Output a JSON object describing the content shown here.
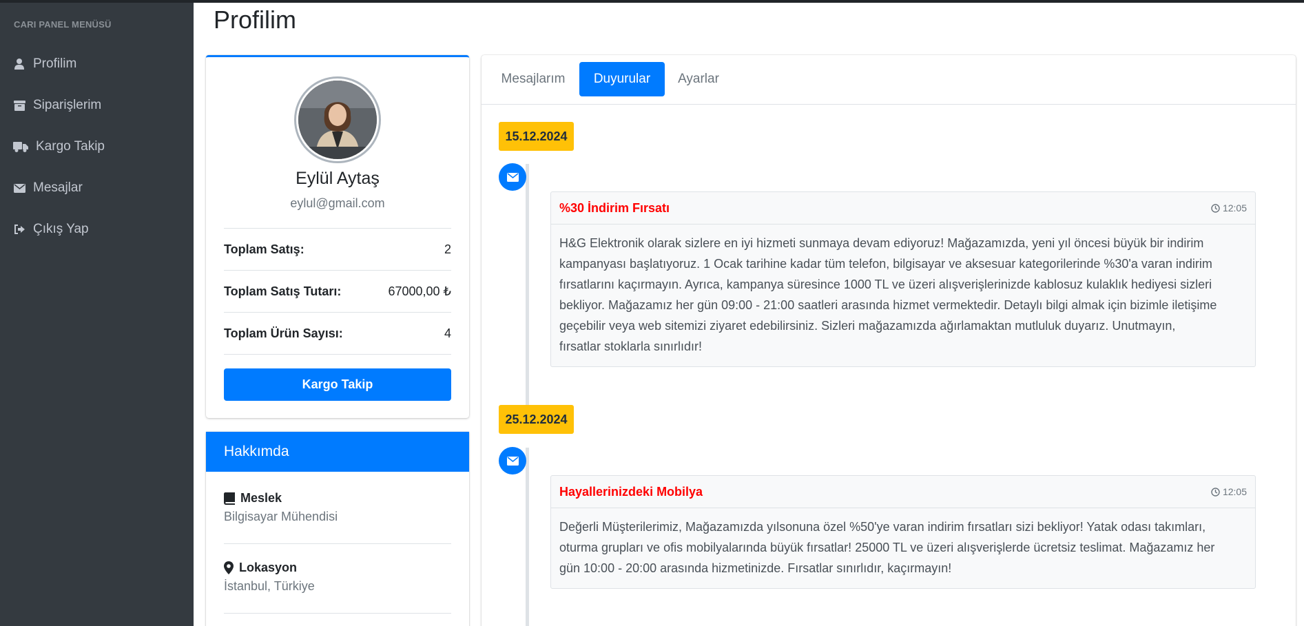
{
  "sidebar": {
    "header": "CARI PANEL MENÜSÜ",
    "items": [
      {
        "label": "Profilim",
        "icon": "user-icon"
      },
      {
        "label": "Siparişlerim",
        "icon": "box-icon"
      },
      {
        "label": "Kargo Takip",
        "icon": "truck-icon"
      },
      {
        "label": "Mesajlar",
        "icon": "envelope-icon"
      },
      {
        "label": "Çıkış Yap",
        "icon": "sign-out-icon"
      }
    ]
  },
  "page": {
    "title": "Profilim"
  },
  "profile": {
    "name": "Eylül Aytaş",
    "email": "eylul@gmail.com",
    "stats": [
      {
        "label": "Toplam Satış:",
        "value": "2"
      },
      {
        "label": "Toplam Satış Tutarı:",
        "value": "67000,00 ₺"
      },
      {
        "label": "Toplam Ürün Sayısı:",
        "value": "4"
      }
    ],
    "button_label": "Kargo Takip"
  },
  "about": {
    "header": "Hakkımda",
    "items": [
      {
        "title": "Meslek",
        "text": "Bilgisayar Mühendisi",
        "icon": "book-icon"
      },
      {
        "title": "Lokasyon",
        "text": "İstanbul, Türkiye",
        "icon": "map-marker-icon"
      }
    ]
  },
  "tabs": [
    {
      "label": "Mesajlarım",
      "active": false
    },
    {
      "label": "Duyurular",
      "active": true
    },
    {
      "label": "Ayarlar",
      "active": false
    }
  ],
  "timeline": [
    {
      "date": "15.12.2024",
      "title": "%30 İndirim Fırsatı",
      "time": "12:05",
      "lines": [
        "H&G Elektronik olarak sizlere en iyi hizmeti sunmaya devam ediyoruz! Mağazamızda, yeni yıl öncesi büyük bir indirim",
        "kampanyası başlatıyoruz. 1 Ocak tarihine kadar tüm telefon, bilgisayar ve aksesuar kategorilerinde %30'a varan indirim",
        "fırsatlarını kaçırmayın. Ayrıca, kampanya süresince 1000 TL ve üzeri alışverişlerinizde kablosuz kulaklık hediyesi sizleri",
        "bekliyor. Mağazamız her gün 09:00 - 21:00 saatleri arasında hizmet vermektedir. Detaylı bilgi almak için bizimle iletişime",
        "geçebilir veya web sitemizi ziyaret edebilirsiniz. Sizleri mağazamızda ağırlamaktan mutluluk duyarız. Unutmayın,",
        "fırsatlar stoklarla sınırlıdır!"
      ]
    },
    {
      "date": "25.12.2024",
      "title": "Hayallerinizdeki Mobilya",
      "time": "12:05",
      "lines": [
        "Değerli Müşterilerimiz, Mağazamızda yılsonuna özel %50'ye varan indirim fırsatları sizi bekliyor! Yatak odası takımları,",
        "oturma grupları ve ofis mobilyalarında büyük fırsatlar! 25000 TL ve üzeri alışverişlerde ücretsiz teslimat. Mağazamız her",
        "gün 10:00 - 20:00 arasında hizmetinizde. Fırsatlar sınırlıdır, kaçırmayın!"
      ]
    }
  ]
}
